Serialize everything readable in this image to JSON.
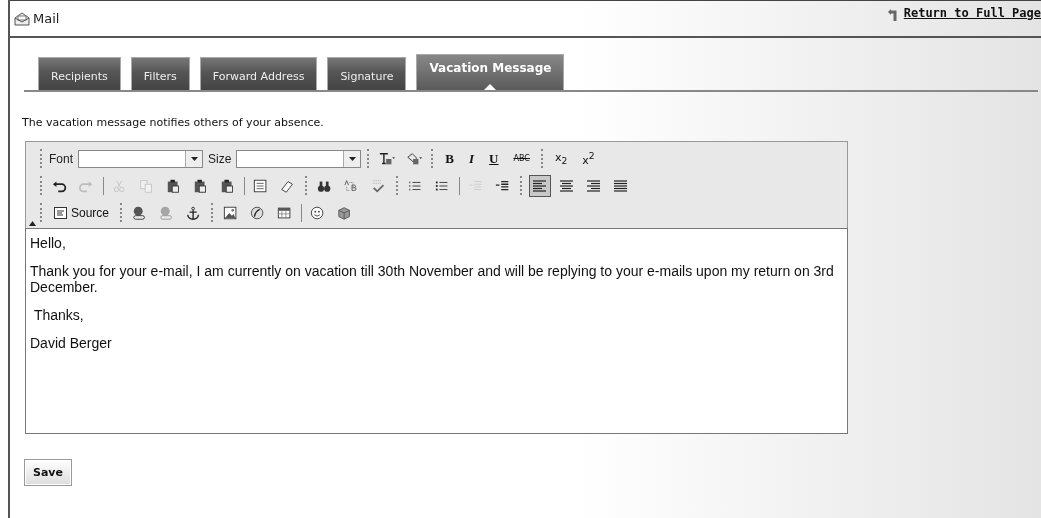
{
  "header": {
    "title": "Mail",
    "return_link": "Return to Full Page"
  },
  "tabs": [
    {
      "label": "Recipients",
      "selected": false
    },
    {
      "label": "Filters",
      "selected": false
    },
    {
      "label": "Forward Address",
      "selected": false
    },
    {
      "label": "Signature",
      "selected": false
    },
    {
      "label": "Vacation Message",
      "selected": true
    }
  ],
  "description": "The vacation message notifies others of your absence.",
  "toolbar": [
    [
      [
        {
          "kind": "label",
          "label": "Font"
        },
        {
          "kind": "combo"
        },
        {
          "kind": "label",
          "label": "Size"
        },
        {
          "kind": "combo"
        }
      ],
      [
        {
          "kind": "textcolor",
          "disabled": false
        },
        {
          "kind": "bgcolor",
          "disabled": false
        }
      ],
      [
        {
          "kind": "bold",
          "label": "B",
          "disabled": false
        },
        {
          "kind": "italic",
          "label": "I",
          "disabled": false
        },
        {
          "kind": "underline",
          "label": "U",
          "disabled": false
        },
        {
          "kind": "strike",
          "label": "ABC",
          "disabled": false
        }
      ],
      [
        {
          "kind": "script",
          "label": "x$_{2}$",
          "disabled": false
        },
        {
          "kind": "script",
          "label": "x$^{2}$",
          "disabled": false
        }
      ]
    ],
    [
      [
        {
          "kind": "undo",
          "disabled": false
        },
        {
          "kind": "redo",
          "disabled": true
        },
        {
          "kind": "sep"
        },
        {
          "kind": "cut",
          "disabled": true
        },
        {
          "kind": "copy",
          "disabled": true
        },
        {
          "kind": "paste",
          "disabled": false
        },
        {
          "kind": "paste",
          "disabled": false
        },
        {
          "kind": "paste",
          "disabled": false
        },
        {
          "kind": "sep"
        },
        {
          "kind": "selectall",
          "disabled": false
        },
        {
          "kind": "eraser",
          "disabled": false
        }
      ],
      [
        {
          "kind": "find",
          "disabled": false
        },
        {
          "kind": "replace",
          "disabled": false
        },
        {
          "kind": "spell",
          "disabled": false
        }
      ],
      [
        {
          "kind": "olist",
          "disabled": false
        },
        {
          "kind": "ulist",
          "disabled": false
        },
        {
          "kind": "sep"
        },
        {
          "kind": "outdent",
          "disabled": true
        },
        {
          "kind": "indent",
          "disabled": false
        }
      ],
      [
        {
          "kind": "alignleft",
          "selected": true
        },
        {
          "kind": "aligncenter",
          "selected": false
        },
        {
          "kind": "alignright",
          "selected": false
        },
        {
          "kind": "justify",
          "selected": false
        }
      ]
    ],
    [
      [
        {
          "kind": "source",
          "label": "Source",
          "disabled": false
        }
      ],
      [
        {
          "kind": "link",
          "disabled": false
        },
        {
          "kind": "link",
          "disabled": true
        },
        {
          "kind": "anchor",
          "disabled": false
        }
      ],
      [
        {
          "kind": "image",
          "disabled": false
        },
        {
          "kind": "flash",
          "disabled": false
        },
        {
          "kind": "table",
          "disabled": false
        },
        {
          "kind": "sep"
        },
        {
          "kind": "smiley",
          "disabled": false
        },
        {
          "kind": "cube",
          "disabled": false
        }
      ]
    ]
  ],
  "message": [
    "Hello,",
    "Thank you for your e-mail, I am currently on vacation till 30th November and will be replying to your e-mails upon my return on 3rd December.",
    " Thanks,",
    "David Berger"
  ],
  "save_button": "Save"
}
